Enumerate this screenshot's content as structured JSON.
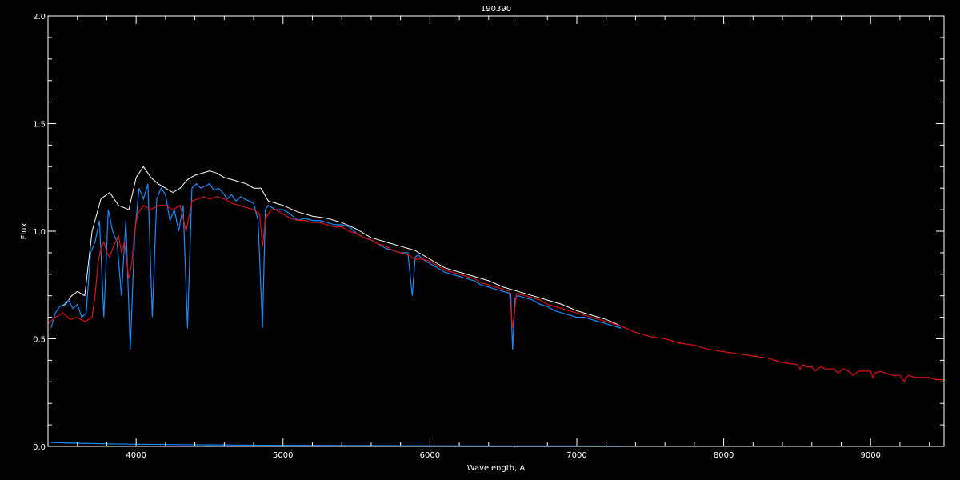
{
  "chart_data": {
    "type": "line",
    "title": "190390",
    "xlabel": "Wavelength, A",
    "ylabel": "Flux",
    "xlim": [
      3400,
      9500
    ],
    "ylim": [
      0.0,
      2.0
    ],
    "x_ticks": [
      4000,
      5000,
      6000,
      7000,
      8000,
      9000
    ],
    "x_tick_labels": [
      "4000",
      "5000",
      "6000",
      "7000",
      "8000",
      "9000"
    ],
    "y_ticks": [
      0.0,
      0.5,
      1.0,
      1.5,
      2.0
    ],
    "y_tick_labels": [
      "0.0",
      "0.5",
      "1.0",
      "1.5",
      "2.0"
    ],
    "background": "#000000",
    "axis_color": "#ffffff",
    "grid": false,
    "series": [
      {
        "color": "#ffffff",
        "x": [
          3480,
          3520,
          3560,
          3600,
          3650,
          3700,
          3760,
          3820,
          3880,
          3950,
          4000,
          4050,
          4100,
          4150,
          4200,
          4250,
          4300,
          4350,
          4400,
          4450,
          4500,
          4550,
          4600,
          4650,
          4700,
          4750,
          4800,
          4850,
          4900,
          4950,
          5000,
          5100,
          5200,
          5300,
          5400,
          5500,
          5600,
          5700,
          5800,
          5900,
          6000,
          6100,
          6200,
          6300,
          6400,
          6500,
          6600,
          6700,
          6800,
          6900,
          7000,
          7100,
          7200,
          7300
        ],
        "y": [
          0.65,
          0.66,
          0.7,
          0.72,
          0.7,
          1.0,
          1.15,
          1.18,
          1.12,
          1.1,
          1.25,
          1.3,
          1.25,
          1.22,
          1.2,
          1.18,
          1.2,
          1.24,
          1.26,
          1.27,
          1.28,
          1.27,
          1.25,
          1.24,
          1.23,
          1.22,
          1.2,
          1.2,
          1.14,
          1.13,
          1.12,
          1.09,
          1.07,
          1.06,
          1.04,
          1.01,
          0.97,
          0.95,
          0.93,
          0.91,
          0.87,
          0.83,
          0.81,
          0.79,
          0.77,
          0.74,
          0.72,
          0.7,
          0.68,
          0.66,
          0.63,
          0.61,
          0.59,
          0.56
        ]
      },
      {
        "color": "#1a8cff",
        "x": [
          3420,
          3450,
          3480,
          3510,
          3540,
          3570,
          3600,
          3630,
          3660,
          3690,
          3720,
          3750,
          3780,
          3810,
          3840,
          3870,
          3900,
          3930,
          3960,
          3990,
          4020,
          4050,
          4080,
          4110,
          4140,
          4170,
          4200,
          4230,
          4260,
          4290,
          4320,
          4350,
          4380,
          4410,
          4440,
          4470,
          4500,
          4530,
          4560,
          4590,
          4620,
          4650,
          4680,
          4710,
          4740,
          4770,
          4800,
          4830,
          4860,
          4880,
          4900,
          4950,
          5000,
          5050,
          5100,
          5150,
          5200,
          5250,
          5300,
          5350,
          5400,
          5450,
          5500,
          5550,
          5600,
          5650,
          5700,
          5750,
          5800,
          5850,
          5880,
          5900,
          5920,
          5950,
          6000,
          6050,
          6100,
          6150,
          6200,
          6250,
          6300,
          6350,
          6400,
          6450,
          6500,
          6550,
          6563,
          6580,
          6600,
          6650,
          6700,
          6750,
          6800,
          6850,
          6900,
          6950,
          7000,
          7050,
          7100,
          7150,
          7200,
          7250,
          7300
        ],
        "y": [
          0.55,
          0.62,
          0.65,
          0.66,
          0.68,
          0.64,
          0.66,
          0.6,
          0.62,
          0.9,
          0.95,
          1.05,
          0.6,
          1.1,
          1.0,
          0.95,
          0.7,
          1.05,
          0.45,
          0.98,
          1.2,
          1.15,
          1.22,
          0.6,
          1.15,
          1.2,
          1.17,
          1.05,
          1.1,
          1.0,
          1.12,
          0.55,
          1.2,
          1.22,
          1.2,
          1.21,
          1.22,
          1.19,
          1.2,
          1.18,
          1.15,
          1.17,
          1.14,
          1.16,
          1.15,
          1.14,
          1.13,
          1.05,
          0.55,
          1.1,
          1.12,
          1.1,
          1.1,
          1.08,
          1.05,
          1.06,
          1.05,
          1.05,
          1.04,
          1.03,
          1.03,
          1.02,
          0.99,
          0.97,
          0.96,
          0.94,
          0.92,
          0.91,
          0.9,
          0.9,
          0.7,
          0.88,
          0.89,
          0.87,
          0.85,
          0.83,
          0.81,
          0.8,
          0.79,
          0.78,
          0.77,
          0.75,
          0.74,
          0.73,
          0.72,
          0.71,
          0.45,
          0.69,
          0.7,
          0.69,
          0.68,
          0.66,
          0.65,
          0.63,
          0.62,
          0.61,
          0.6,
          0.6,
          0.59,
          0.58,
          0.57,
          0.56,
          0.55
        ]
      },
      {
        "color": "#e01010",
        "x": [
          3400,
          3450,
          3500,
          3550,
          3600,
          3650,
          3700,
          3720,
          3740,
          3760,
          3780,
          3800,
          3820,
          3840,
          3860,
          3880,
          3900,
          3920,
          3950,
          3970,
          3990,
          4010,
          4050,
          4100,
          4150,
          4200,
          4250,
          4300,
          4340,
          4380,
          4420,
          4460,
          4500,
          4550,
          4600,
          4650,
          4700,
          4750,
          4800,
          4840,
          4861,
          4880,
          4920,
          4950,
          5000,
          5050,
          5100,
          5150,
          5200,
          5250,
          5300,
          5350,
          5400,
          5450,
          5500,
          5550,
          5600,
          5650,
          5700,
          5750,
          5800,
          5850,
          5900,
          5950,
          6000,
          6050,
          6100,
          6150,
          6200,
          6250,
          6300,
          6350,
          6400,
          6450,
          6500,
          6540,
          6563,
          6590,
          6650,
          6700,
          6750,
          6800,
          6850,
          6900,
          6950,
          7000,
          7100,
          7200,
          7300,
          7400,
          7500,
          7600,
          7700,
          7800,
          7900,
          8000,
          8100,
          8200,
          8300,
          8400,
          8500,
          8520,
          8542,
          8560,
          8600,
          8620,
          8662,
          8690,
          8750,
          8780,
          8810,
          8850,
          8880,
          8920,
          9000,
          9015,
          9030,
          9070,
          9100,
          9150,
          9200,
          9230,
          9240,
          9260,
          9300,
          9350,
          9400,
          9450,
          9500
        ],
        "y": [
          0.57,
          0.6,
          0.62,
          0.59,
          0.6,
          0.58,
          0.6,
          0.7,
          0.85,
          0.92,
          0.95,
          0.9,
          0.88,
          0.92,
          0.95,
          0.98,
          0.9,
          0.95,
          0.78,
          0.85,
          1.0,
          1.08,
          1.12,
          1.1,
          1.12,
          1.12,
          1.1,
          1.12,
          1.0,
          1.14,
          1.15,
          1.16,
          1.15,
          1.16,
          1.15,
          1.13,
          1.12,
          1.11,
          1.1,
          1.08,
          0.93,
          1.06,
          1.1,
          1.1,
          1.08,
          1.06,
          1.05,
          1.05,
          1.04,
          1.04,
          1.03,
          1.02,
          1.02,
          1.0,
          0.99,
          0.97,
          0.96,
          0.94,
          0.93,
          0.91,
          0.9,
          0.89,
          0.87,
          0.87,
          0.86,
          0.84,
          0.82,
          0.81,
          0.8,
          0.79,
          0.78,
          0.76,
          0.75,
          0.74,
          0.73,
          0.72,
          0.55,
          0.71,
          0.7,
          0.69,
          0.68,
          0.66,
          0.65,
          0.64,
          0.63,
          0.62,
          0.6,
          0.58,
          0.56,
          0.53,
          0.51,
          0.5,
          0.48,
          0.47,
          0.45,
          0.44,
          0.43,
          0.42,
          0.41,
          0.39,
          0.38,
          0.36,
          0.38,
          0.37,
          0.37,
          0.35,
          0.37,
          0.36,
          0.36,
          0.34,
          0.36,
          0.35,
          0.33,
          0.35,
          0.35,
          0.32,
          0.34,
          0.35,
          0.34,
          0.33,
          0.33,
          0.3,
          0.32,
          0.33,
          0.32,
          0.32,
          0.32,
          0.31,
          0.31
        ]
      },
      {
        "color": "#1a8cff",
        "x": [
          3420,
          3600,
          3800,
          4000,
          4500,
          5000,
          5500,
          6000,
          6500,
          7000,
          7300
        ],
        "y": [
          0.018,
          0.015,
          0.012,
          0.01,
          0.007,
          0.005,
          0.004,
          0.003,
          0.002,
          0.002,
          0.001
        ]
      }
    ]
  }
}
